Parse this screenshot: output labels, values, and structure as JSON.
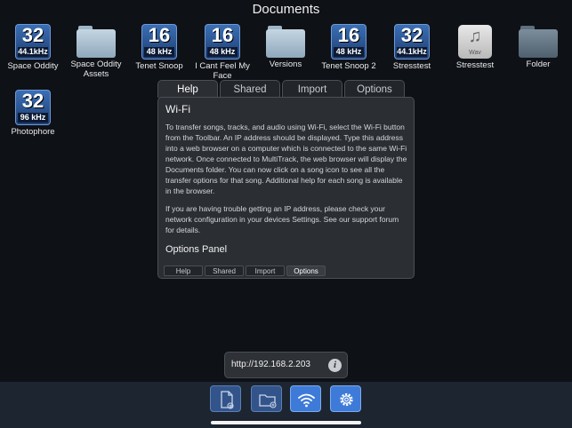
{
  "header": {
    "title": "Documents"
  },
  "files": [
    {
      "kind": "badge",
      "bits": "32",
      "rate": "44.1kHz",
      "label": "Space Oddity"
    },
    {
      "kind": "folder",
      "label": "Space Oddity Assets"
    },
    {
      "kind": "badge",
      "bits": "16",
      "rate": "48 kHz",
      "label": "Tenet Snoop"
    },
    {
      "kind": "badge",
      "bits": "16",
      "rate": "48 kHz",
      "label": "I Cant Feel My Face"
    },
    {
      "kind": "folder",
      "label": "Versions"
    },
    {
      "kind": "badge",
      "bits": "16",
      "rate": "48 kHz",
      "label": "Tenet Snoop 2"
    },
    {
      "kind": "badge",
      "bits": "32",
      "rate": "44.1kHz",
      "label": "Stresstest"
    },
    {
      "kind": "wav",
      "badge_text": "Wav",
      "label": "Stresstest"
    },
    {
      "kind": "folder-dark",
      "label": "Folder"
    },
    {
      "kind": "badge",
      "bits": "32",
      "rate": "96 kHz",
      "label": "Photophore"
    }
  ],
  "help_panel": {
    "tabs": [
      "Help",
      "Shared",
      "Import",
      "Options"
    ],
    "active_tab": "Help",
    "heading": "Wi-Fi",
    "paragraph1": "To transfer songs, tracks, and audio using Wi-Fi, select the Wi-Fi button from the Toolbar. An IP address should be displayed. Type this address into a web browser on a computer which is connected to the same Wi-Fi network. Once connected to MultiTrack, the web browser will display the Documents folder. You can now click on a song icon to see all the transfer options for that song. Additional help for each song is available in the browser.",
    "paragraph2": "If you are having trouble getting an IP address, please check your network configuration in your devices Settings. See our support forum for details.",
    "subheading": "Options Panel",
    "mini_tabs": [
      "Help",
      "Shared",
      "Import",
      "Options"
    ],
    "mini_active": "Options"
  },
  "wifi": {
    "ip_address": "http://192.168.2.203",
    "info_glyph": "i"
  },
  "toolbar": {
    "buttons": [
      {
        "icon": "new-document-icon",
        "active": false
      },
      {
        "icon": "new-folder-icon",
        "active": false
      },
      {
        "icon": "wifi-icon",
        "active": true
      },
      {
        "icon": "gear-icon",
        "active": true
      }
    ]
  }
}
